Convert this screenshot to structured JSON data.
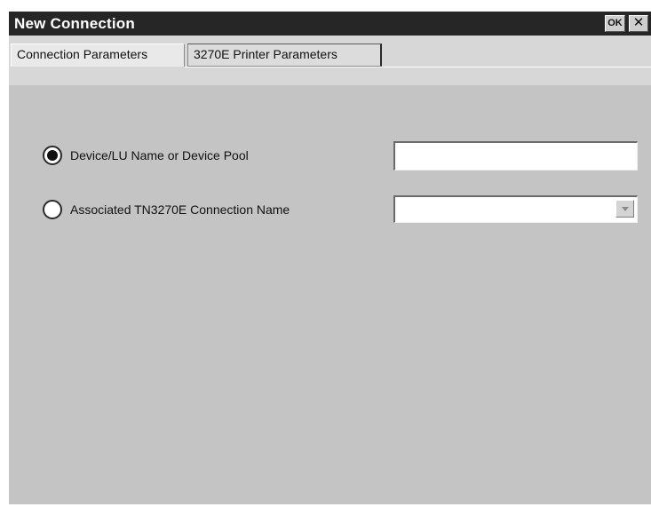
{
  "window": {
    "title": "New Connection",
    "ok_label": "OK",
    "close_label": "✕"
  },
  "tabs": [
    {
      "label": "Connection Parameters",
      "selected": true
    },
    {
      "label": "3270E Printer Parameters",
      "selected": false
    }
  ],
  "form": {
    "options": [
      {
        "label": "Device/LU Name or Device Pool",
        "checked": true
      },
      {
        "label": "Associated TN3270E Connection Name",
        "checked": false
      }
    ],
    "device_name_value": "",
    "connection_name_value": ""
  },
  "colors": {
    "titlebar": "#262626",
    "dialog_background": "#c4c4c4",
    "tab_strip": "#d7d7d7"
  },
  "icons": {
    "dropdown": "chevron-down-icon"
  }
}
